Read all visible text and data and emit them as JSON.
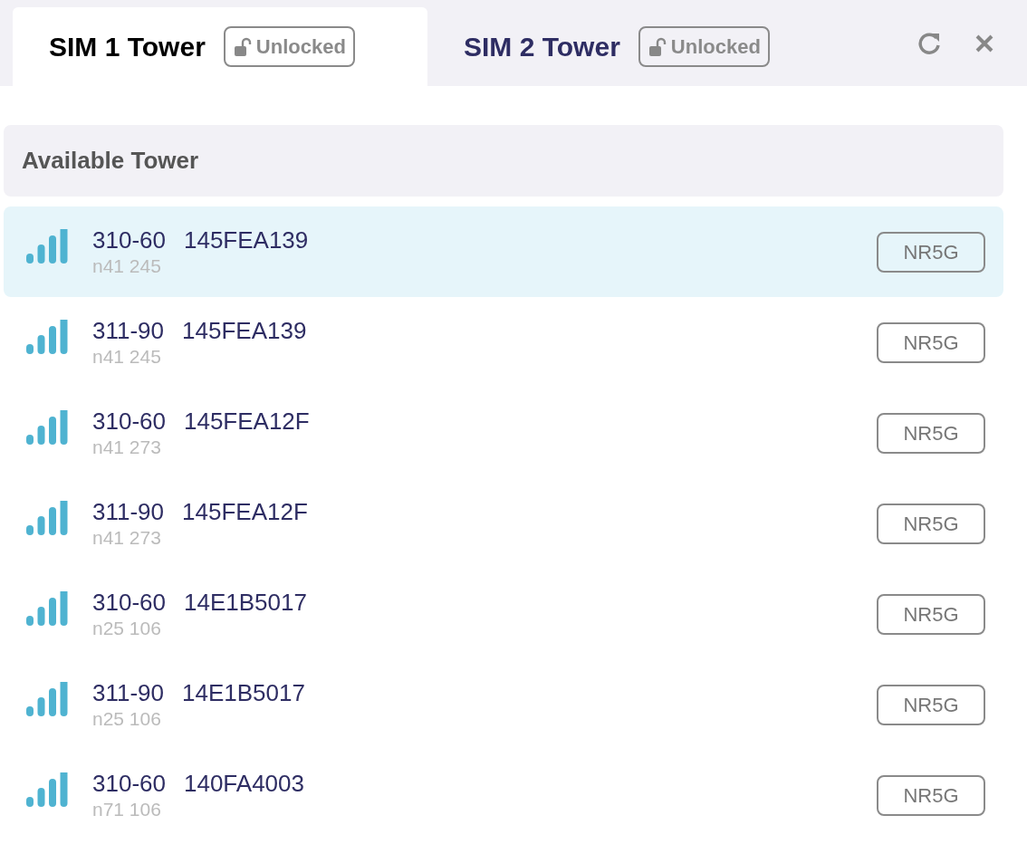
{
  "tabs": [
    {
      "label": "SIM 1 Tower",
      "selected": true,
      "lock": {
        "label": "Unlocked",
        "locked": false
      }
    },
    {
      "label": "SIM 2 Tower",
      "selected": false,
      "lock": {
        "label": "Unlocked",
        "locked": false
      }
    }
  ],
  "section": {
    "title": "Available Tower"
  },
  "towers": [
    {
      "operator": "310-60",
      "cell_id": "145FEA139",
      "band": "n41 245",
      "tech": "NR5G",
      "selected": true
    },
    {
      "operator": "311-90",
      "cell_id": "145FEA139",
      "band": "n41 245",
      "tech": "NR5G",
      "selected": false
    },
    {
      "operator": "310-60",
      "cell_id": "145FEA12F",
      "band": "n41 273",
      "tech": "NR5G",
      "selected": false
    },
    {
      "operator": "311-90",
      "cell_id": "145FEA12F",
      "band": "n41 273",
      "tech": "NR5G",
      "selected": false
    },
    {
      "operator": "310-60",
      "cell_id": "14E1B5017",
      "band": "n25 106",
      "tech": "NR5G",
      "selected": false
    },
    {
      "operator": "311-90",
      "cell_id": "14E1B5017",
      "band": "n25 106",
      "tech": "NR5G",
      "selected": false
    },
    {
      "operator": "310-60",
      "cell_id": "140FA4003",
      "band": "n71 106",
      "tech": "NR5G",
      "selected": false
    }
  ]
}
